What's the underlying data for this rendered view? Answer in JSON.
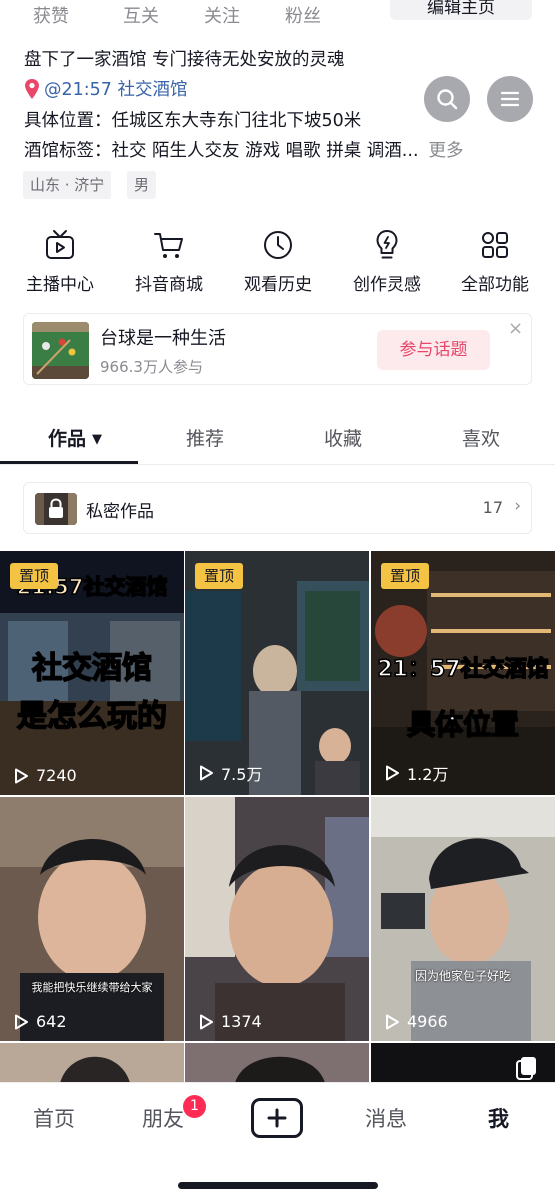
{
  "header": {
    "stats": [
      "获赞",
      "互关",
      "关注",
      "粉丝"
    ],
    "edit_button": "编辑主页"
  },
  "bio": {
    "line1": "盘下了一家酒馆  专门接待无处安放的灵魂",
    "location_tag": "@21:57 社交酒馆",
    "line3": "具体位置：任城区东大寺东门往北下坡50米",
    "line4": "酒馆标签：社交 陌生人交友 游戏 唱歌 拼桌 调酒...",
    "more": "更多"
  },
  "tags": [
    "山东 · 济宁",
    "男"
  ],
  "features": [
    {
      "label": "主播中心",
      "icon": "tv-icon"
    },
    {
      "label": "抖音商城",
      "icon": "cart-icon"
    },
    {
      "label": "观看历史",
      "icon": "clock-icon"
    },
    {
      "label": "创作灵感",
      "icon": "bulb-icon"
    },
    {
      "label": "全部功能",
      "icon": "grid-icon"
    }
  ],
  "topic": {
    "title": "台球是一种生活",
    "subtitle": "966.3万人参与",
    "button": "参与话题",
    "close": "×"
  },
  "tabs": [
    "作品",
    "推荐",
    "收藏",
    "喜欢"
  ],
  "private": {
    "label": "私密作品",
    "count": "17",
    "chevron": "›"
  },
  "videos": [
    {
      "pinned": "置顶",
      "title_lines": [
        "社交酒馆",
        "是怎么玩的"
      ],
      "header_text": "21:57社交酒馆",
      "plays": "7240"
    },
    {
      "pinned": "置顶",
      "title_lines": [],
      "plays": "7.5万"
    },
    {
      "pinned": "置顶",
      "title_lines": [
        "21：57社交酒馆",
        "具体位置"
      ],
      "plays": "1.2万"
    },
    {
      "subtitle": "我能把快乐继续带给大家",
      "plays": "642"
    },
    {
      "plays": "1374"
    },
    {
      "subtitle": "因为他家包子好吃",
      "plays": "4966"
    }
  ],
  "bottom_nav": {
    "home": "首页",
    "friends": "朋友",
    "friends_badge": "1",
    "messages": "消息",
    "me": "我"
  },
  "colors": {
    "accent": "#fe2c55",
    "link": "#3a64a8",
    "pin_badge": "#f5c344"
  }
}
